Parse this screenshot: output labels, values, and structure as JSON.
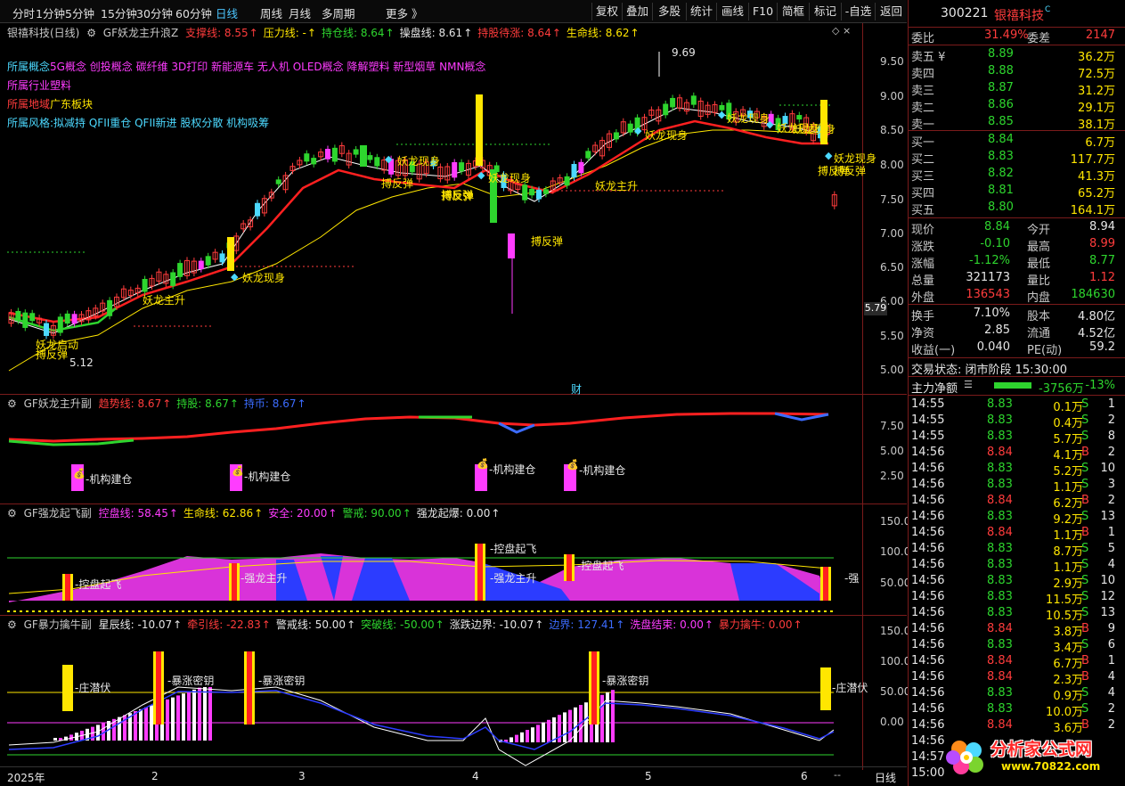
{
  "toolbar": {
    "left_tabs": [
      "分时",
      "1分钟",
      "5分钟",
      "15分钟",
      "30分钟",
      "60分钟",
      "日线",
      "周线",
      "月线",
      "多周期",
      "更多 》"
    ],
    "active_tab": "日线",
    "right_buttons": [
      "复权",
      "叠加",
      "多股",
      "统计",
      "画线",
      "F10",
      "简框",
      "标记",
      "-自选",
      "返回"
    ]
  },
  "main_panel": {
    "title": "银禧科技(日线)",
    "indicator": "GF妖龙主升浪Z",
    "params": [
      {
        "label": "支撑线: 8.55",
        "color": "#ff3c3c"
      },
      {
        "label": "压力线: -",
        "color": "#ffe600"
      },
      {
        "label": "持仓线: 8.64",
        "color": "#2ed52e"
      },
      {
        "label": "操盘线: 8.61",
        "color": "#e6e6e6"
      },
      {
        "label": "持股待涨: 8.64",
        "color": "#ff3c3c"
      },
      {
        "label": "生命线: 8.62",
        "color": "#ffe600"
      }
    ],
    "info_lines": [
      {
        "label": "所属概念",
        "text": "5G概念 创投概念 碳纤维 3D打印 新能源车 无人机 OLED概念 降解塑料 新型烟草 NMN概念",
        "label_color": "#4cd9ff",
        "text_color": "#ff3cff"
      },
      {
        "label": "所属行业",
        "text": "塑料",
        "label_color": "#ff3cff",
        "text_color": "#ff3cff"
      },
      {
        "label": "所属地域",
        "text": "广东板块",
        "label_color": "#ff3c3c",
        "text_color": "#ffe600"
      },
      {
        "label": "所属风格:",
        "text": "拟减持 QFII重仓 QFII新进 股权分散 机构吸筹",
        "label_color": "#4cd9ff",
        "text_color": "#4cd9ff"
      }
    ],
    "y_ticks": [
      "9.50",
      "9.00",
      "8.50",
      "8.00",
      "7.50",
      "7.00",
      "6.50",
      "6.00",
      "5.50",
      "5.00"
    ],
    "current_price_tag": "5.79",
    "high_label": "9.69",
    "low_label": "5.12",
    "event_label": "财",
    "signals": [
      "妖龙启动",
      "搏反弹",
      "妖龙主升",
      "妖龙现身",
      "搏反弹",
      "妖龙现身",
      "妖龙现身",
      "搏反弹",
      "搏反弹",
      "妖龙现身",
      "搏反弹",
      "妖龙主升",
      "妖龙现身",
      "妖龙现身",
      "妖龙现身",
      "搏反弹",
      "妖龙现身",
      "搏反弹"
    ]
  },
  "panel2": {
    "indicator": "GF妖龙主升副",
    "params": [
      {
        "label": "趋势线: 8.67",
        "color": "#ff3c3c"
      },
      {
        "label": "持股: 8.67",
        "color": "#2ed52e"
      },
      {
        "label": "持币: 8.67",
        "color": "#3c6cff"
      }
    ],
    "y_ticks": [
      "7.50",
      "5.00",
      "2.50"
    ],
    "signals": [
      "机构建仓",
      "机构建仓",
      "机构建仓",
      "机构建仓"
    ]
  },
  "panel3": {
    "indicator": "GF强龙起飞副",
    "params": [
      {
        "label": "控盘线: 58.45",
        "color": "#ff3cff"
      },
      {
        "label": "生命线: 62.86",
        "color": "#ffe600"
      },
      {
        "label": "安全: 20.00",
        "color": "#ff3cff"
      },
      {
        "label": "警戒: 90.00",
        "color": "#2ed52e"
      },
      {
        "label": "强龙起爆: 0.00",
        "color": "#e6e6e6"
      }
    ],
    "y_ticks": [
      "150.0",
      "100.0",
      "50.00"
    ],
    "signals": [
      "控盘起飞",
      "强龙主升",
      "控盘起飞",
      "强龙主升",
      "控盘起飞",
      "强"
    ]
  },
  "panel4": {
    "indicator": "GF暴力擒牛副",
    "params": [
      {
        "label": "星辰线: -10.07",
        "color": "#e6e6e6"
      },
      {
        "label": "牵引线: -22.83",
        "color": "#ff3c3c"
      },
      {
        "label": "警戒线: 50.00",
        "color": "#e6e6e6"
      },
      {
        "label": "突破线: -50.00",
        "color": "#2ed52e"
      },
      {
        "label": "涨跌边界: -10.07",
        "color": "#e6e6e6"
      },
      {
        "label": "边界: 127.41",
        "color": "#3c6cff"
      },
      {
        "label": "洗盘结束: 0.00",
        "color": "#ff3cff"
      },
      {
        "label": "暴力擒牛: 0.00",
        "color": "#ff3c3c"
      }
    ],
    "y_ticks": [
      "150.0",
      "100.0",
      "50.00",
      "0.00"
    ],
    "signals": [
      "庄潜伏",
      "暴涨密钥",
      "暴涨密钥",
      "暴涨密钥",
      "庄潜伏"
    ]
  },
  "x_axis": {
    "labels": [
      "2025年",
      "2",
      "3",
      "4",
      "5",
      "6"
    ],
    "period": "日线"
  },
  "quote": {
    "code": "300221",
    "name": "银禧科技",
    "wei_bi": "31.49%",
    "wei_cha": "2147",
    "asks": [
      {
        "label": "卖五 ¥",
        "price": "8.89",
        "vol": "36.2万"
      },
      {
        "label": "卖四",
        "price": "8.88",
        "vol": "72.5万"
      },
      {
        "label": "卖三",
        "price": "8.87",
        "vol": "31.2万"
      },
      {
        "label": "卖二",
        "price": "8.86",
        "vol": "29.1万"
      },
      {
        "label": "卖一",
        "price": "8.85",
        "vol": "38.1万"
      }
    ],
    "bids": [
      {
        "label": "买一",
        "price": "8.84",
        "vol": "6.7万"
      },
      {
        "label": "买二",
        "price": "8.83",
        "vol": "117.7万"
      },
      {
        "label": "买三",
        "price": "8.82",
        "vol": "41.3万"
      },
      {
        "label": "买四",
        "price": "8.81",
        "vol": "65.2万"
      },
      {
        "label": "买五",
        "price": "8.80",
        "vol": "164.1万"
      }
    ],
    "stats": [
      {
        "l1": "现价",
        "v1": "8.84",
        "c1": "#2ed52e",
        "l2": "今开",
        "v2": "8.94",
        "c2": "#e6e6e6"
      },
      {
        "l1": "涨跌",
        "v1": "-0.10",
        "c1": "#2ed52e",
        "l2": "最高",
        "v2": "8.99",
        "c2": "#ff3c3c"
      },
      {
        "l1": "涨幅",
        "v1": "-1.12%",
        "c1": "#2ed52e",
        "l2": "最低",
        "v2": "8.77",
        "c2": "#2ed52e"
      },
      {
        "l1": "总量",
        "v1": "321173",
        "c1": "#e6e6e6",
        "l2": "量比",
        "v2": "1.12",
        "c2": "#ff3c3c"
      },
      {
        "l1": "外盘",
        "v1": "136543",
        "c1": "#ff3c3c",
        "l2": "内盘",
        "v2": "184630",
        "c2": "#2ed52e"
      }
    ],
    "stats2": [
      {
        "l1": "换手",
        "v1": "7.10%",
        "l2": "股本",
        "v2": "4.80亿"
      },
      {
        "l1": "净资",
        "v1": "2.85",
        "l2": "流通",
        "v2": "4.52亿"
      },
      {
        "l1": "收益(一)",
        "v1": "0.040",
        "l2": "PE(动)",
        "v2": "59.2"
      }
    ],
    "trade_status": "交易状态: 闭市阶段 15:30:00",
    "net_flow_label": "主力净额",
    "net_flow_value": "-3756万",
    "net_flow_pct": "-13%",
    "ticks": [
      {
        "t": "14:55",
        "p": "8.83",
        "v": "0.1万",
        "d": "S",
        "n": "1"
      },
      {
        "t": "14:55",
        "p": "8.83",
        "v": "0.4万",
        "d": "S",
        "n": "2"
      },
      {
        "t": "14:55",
        "p": "8.83",
        "v": "5.7万",
        "d": "S",
        "n": "8"
      },
      {
        "t": "14:56",
        "p": "8.84",
        "v": "4.1万",
        "d": "B",
        "n": "2"
      },
      {
        "t": "14:56",
        "p": "8.83",
        "v": "5.2万",
        "d": "S",
        "n": "10"
      },
      {
        "t": "14:56",
        "p": "8.83",
        "v": "1.1万",
        "d": "S",
        "n": "3"
      },
      {
        "t": "14:56",
        "p": "8.84",
        "v": "6.2万",
        "d": "B",
        "n": "2"
      },
      {
        "t": "14:56",
        "p": "8.83",
        "v": "9.2万",
        "d": "S",
        "n": "13"
      },
      {
        "t": "14:56",
        "p": "8.84",
        "v": "1.1万",
        "d": "B",
        "n": "1"
      },
      {
        "t": "14:56",
        "p": "8.83",
        "v": "8.7万",
        "d": "S",
        "n": "5"
      },
      {
        "t": "14:56",
        "p": "8.83",
        "v": "1.1万",
        "d": "S",
        "n": "4"
      },
      {
        "t": "14:56",
        "p": "8.83",
        "v": "2.9万",
        "d": "S",
        "n": "10"
      },
      {
        "t": "14:56",
        "p": "8.83",
        "v": "11.5万",
        "d": "S",
        "n": "12"
      },
      {
        "t": "14:56",
        "p": "8.83",
        "v": "10.5万",
        "d": "S",
        "n": "13"
      },
      {
        "t": "14:56",
        "p": "8.84",
        "v": "3.8万",
        "d": "B",
        "n": "9"
      },
      {
        "t": "14:56",
        "p": "8.83",
        "v": "3.4万",
        "d": "S",
        "n": "6"
      },
      {
        "t": "14:56",
        "p": "8.84",
        "v": "6.7万",
        "d": "B",
        "n": "1"
      },
      {
        "t": "14:56",
        "p": "8.84",
        "v": "2.3万",
        "d": "B",
        "n": "4"
      },
      {
        "t": "14:56",
        "p": "8.83",
        "v": "0.9万",
        "d": "S",
        "n": "4"
      },
      {
        "t": "14:56",
        "p": "8.83",
        "v": "10.0万",
        "d": "S",
        "n": "2"
      },
      {
        "t": "14:56",
        "p": "8.84",
        "v": "3.6万",
        "d": "B",
        "n": "2"
      },
      {
        "t": "14:56",
        "p": "",
        "v": "",
        "d": "",
        "n": ""
      },
      {
        "t": "14:57",
        "p": "",
        "v": "",
        "d": "",
        "n": ""
      },
      {
        "t": "15:00",
        "p": "",
        "v": "",
        "d": "",
        "n": ""
      }
    ]
  },
  "watermark": {
    "title": "分析家公式网",
    "url": "www.70822.com"
  },
  "colors": {
    "up": "#ff3c3c",
    "down": "#2ed52e",
    "cyan_candle": "#4cd9ff",
    "magenta": "#ff3cff",
    "yellow": "#ffe600",
    "frame": "#7a1b1b"
  }
}
